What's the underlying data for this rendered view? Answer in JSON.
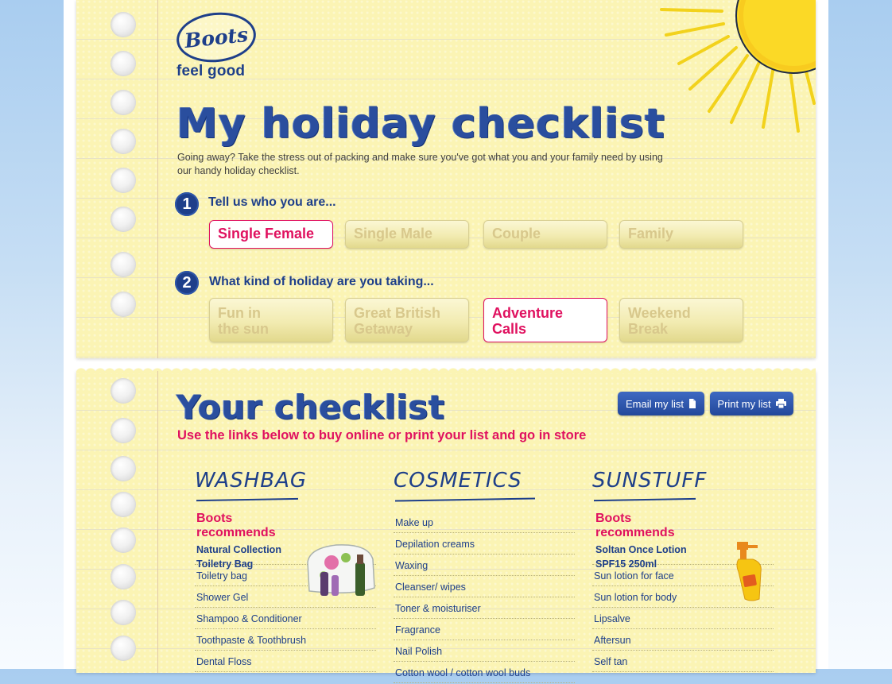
{
  "brand": {
    "logo_text": "Boots",
    "tagline": "feel good"
  },
  "header": {
    "title": "My holiday checklist",
    "intro": "Going away? Take the stress out of packing and make sure you've got what you and your family need by using our handy holiday checklist."
  },
  "step1": {
    "number": "1",
    "label": "Tell us who you are...",
    "options": [
      "Single Female",
      "Single Male",
      "Couple",
      "Family"
    ],
    "selected": "Single Female"
  },
  "step2": {
    "number": "2",
    "label": "What kind of holiday are you taking...",
    "options": [
      {
        "line1": "Fun in",
        "line2": "the sun"
      },
      {
        "line1": "Great British",
        "line2": "Getaway"
      },
      {
        "line1": "Adventure",
        "line2": "Calls"
      },
      {
        "line1": "Weekend",
        "line2": "Break"
      }
    ],
    "selected": "Adventure Calls"
  },
  "checklist": {
    "title": "Your checklist",
    "subtitle": "Use the links below to buy online or print your list and go in store",
    "email_label": "Email my list",
    "print_label": "Print my list",
    "columns": [
      {
        "heading": "WASHBAG",
        "recommend": {
          "line1": "Boots",
          "line2": "recommends",
          "product1": "Natural Collection",
          "product2": "Toiletry Bag"
        },
        "items": [
          "Toiletry bag",
          "Shower Gel",
          "Shampoo & Conditioner",
          "Toothpaste & Toothbrush",
          "Dental Floss"
        ]
      },
      {
        "heading": "COSMETICS",
        "items": [
          "Make up",
          "Depilation creams",
          "Waxing",
          "Cleanser/ wipes",
          "Toner & moisturiser",
          "Fragrance",
          "Nail Polish",
          "Cotton wool / cotton wool buds"
        ]
      },
      {
        "heading": "SUNSTUFF",
        "recommend": {
          "line1": "Boots",
          "line2": "recommends",
          "product1": "Soltan Once Lotion",
          "product2": "SPF15 250ml"
        },
        "items": [
          "Sun lotion for face",
          "Sun lotion for body",
          "Lipsalve",
          "Aftersun",
          "Self tan"
        ]
      }
    ]
  },
  "colors": {
    "brand_blue": "#1e3f8a",
    "accent_pink": "#e0115f",
    "paper": "#fbf4b4"
  }
}
